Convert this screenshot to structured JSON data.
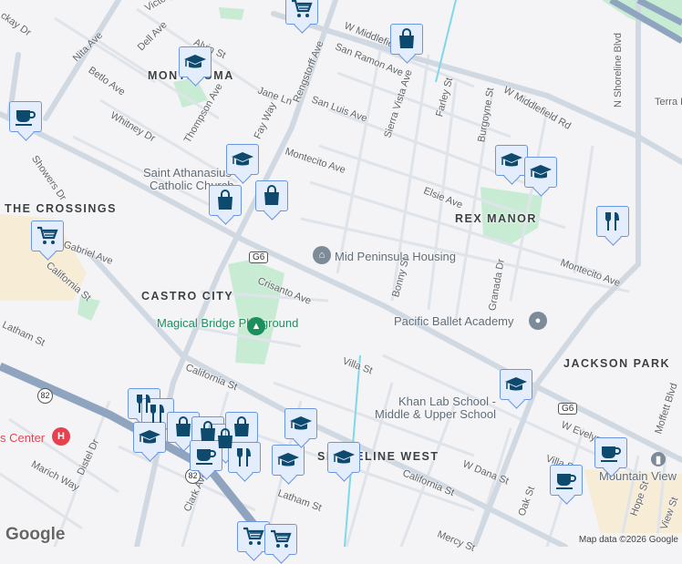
{
  "colors": {
    "background": "#f4f3f5",
    "road": "#d3dbe3",
    "highway": "#8fa5bf",
    "park": "#c8ecd3",
    "marker_bg": "#e4edfc",
    "marker_border": "#6a96e0",
    "marker_icon": "#0d4a6e"
  },
  "areas": [
    "MONTEZUMA",
    "THE CROSSINGS",
    "CASTRO CITY",
    "REX MANOR",
    "JACKSON PARK",
    "SHORELINE WEST"
  ],
  "pois": {
    "housing": "Mid Peninsula Housing",
    "ballet": "Pacific Ballet Academy",
    "park": "Magical Bridge Playground",
    "khan1": "Khan Lab School -",
    "khan2": "Middle & Upper School",
    "church1": "Saint Athanasius",
    "church2": "Catholic Church",
    "hospital": "s Center",
    "station": "Mountain View"
  },
  "streets": [
    "Victory",
    "Dell Ave",
    "Alvin St",
    "Nita Ave",
    "Betlo Ave",
    "Whitney Dr",
    "Thompson Ave",
    "Fay Way",
    "Jane Ln",
    "Rengstorff Ave",
    "San Luis Ave",
    "Montecito Ave",
    "Showers Dr",
    "Gabriel Ave",
    "California St",
    "Latham St",
    "Crisanto Ave",
    "California St",
    "Villa St",
    "Marich Way",
    "Distel Dr",
    "Clark Ave",
    "Latham St",
    "California St",
    "W Dana St",
    "Mercy St",
    "Oak St",
    "W Evelyn",
    "Hope St",
    "View St",
    "Moffett Blvd",
    "Bonny St",
    "Granada Dr",
    "Elsie Ave",
    "Burgoyne St",
    "Farley St",
    "Sierra Vista Ave",
    "San Ramon Ave",
    "W Middlefield Rd",
    "W Middlefield Rd",
    "N Shoreline Blvd",
    "Terra Bella",
    "Montecito Ave",
    "Villa St",
    "ckay Dr"
  ],
  "shields": {
    "g6": "G6",
    "r82": "82"
  },
  "markers": [
    "shopping-cart",
    "shopping-bag",
    "graduation-cap",
    "coffee-cup",
    "graduation-cap",
    "shopping-bag",
    "shopping-bag",
    "shopping-cart",
    "graduation-cap",
    "graduation-cap",
    "fork-knife",
    "graduation-cap",
    "coffee-cup",
    "coffee-cup",
    "fork-knife",
    "fork-knife",
    "shopping-bag",
    "shopping-bag",
    "graduation-cap",
    "shopping-bag",
    "shopping-bag",
    "coffee-cup",
    "fork-knife",
    "graduation-cap",
    "graduation-cap",
    "graduation-cap",
    "shopping-cart",
    "shopping-cart"
  ],
  "attribution": "Map data ©2026 Google",
  "logo": "Google"
}
